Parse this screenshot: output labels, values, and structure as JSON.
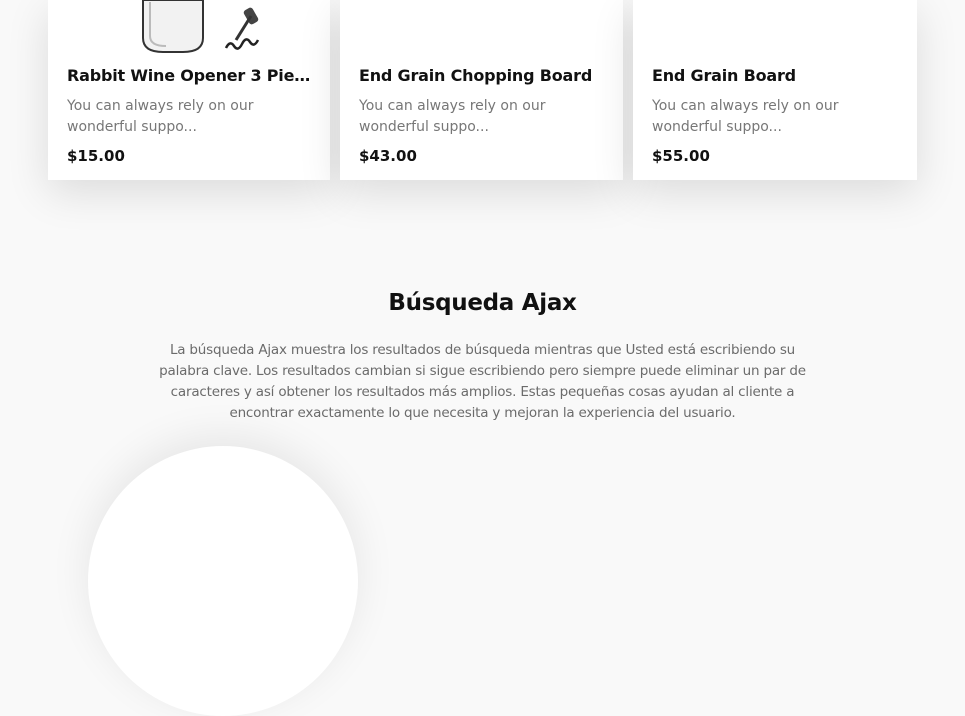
{
  "products": [
    {
      "title": "Rabbit Wine Opener 3 Piece ...",
      "description": "You can always rely on our wonderful suppo...",
      "price": "$15.00"
    },
    {
      "title": "End Grain Chopping Board",
      "description": "You can always rely on our wonderful suppo...",
      "price": "$43.00"
    },
    {
      "title": "End Grain Board",
      "description": "You can always rely on our wonderful suppo...",
      "price": "$55.00"
    }
  ],
  "section": {
    "title": "Búsqueda Ajax",
    "text": "La búsqueda Ajax muestra los resultados de búsqueda mientras que Usted está escribiendo su palabra clave. Los resultados cambian si sigue escribiendo pero siempre puede eliminar un par de caracteres y así obtener los resultados más amplios. Estas pequeñas cosas ayudan al cliente a encontrar exactamente lo que necesita y mejoran la experiencia del usuario."
  },
  "icons": {
    "product_image_1": "wine-opener-image"
  }
}
